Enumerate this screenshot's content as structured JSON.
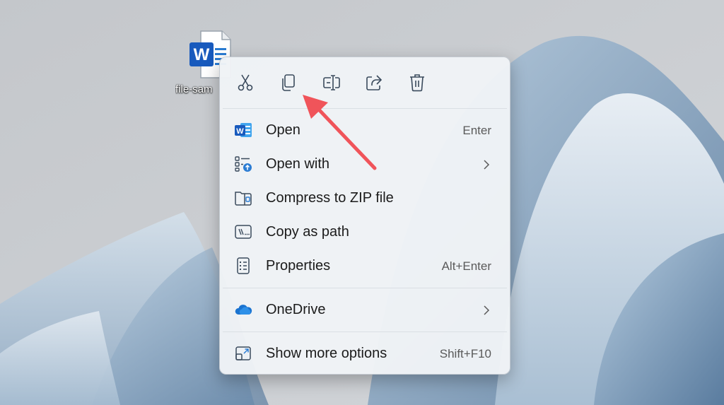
{
  "desktop": {
    "file_icon": {
      "icon": "word-document-icon",
      "label": "file-sam"
    }
  },
  "context_menu": {
    "quick_actions": [
      {
        "name": "cut-button",
        "icon": "scissors-icon"
      },
      {
        "name": "copy-button",
        "icon": "copy-icon"
      },
      {
        "name": "rename-button",
        "icon": "rename-icon"
      },
      {
        "name": "share-button",
        "icon": "share-icon"
      },
      {
        "name": "delete-button",
        "icon": "trash-icon"
      }
    ],
    "items": [
      {
        "label": "Open",
        "shortcut": "Enter",
        "icon": "word-icon"
      },
      {
        "label": "Open with",
        "shortcut": "",
        "icon": "open-with-icon",
        "submenu": true
      },
      {
        "label": "Compress to ZIP file",
        "shortcut": "",
        "icon": "zip-folder-icon"
      },
      {
        "label": "Copy as path",
        "shortcut": "",
        "icon": "path-icon"
      },
      {
        "label": "Properties",
        "shortcut": "Alt+Enter",
        "icon": "properties-icon"
      },
      {
        "label": "OneDrive",
        "shortcut": "",
        "icon": "onedrive-cloud-icon",
        "submenu": true
      },
      {
        "label": "Show more options",
        "shortcut": "Shift+F10",
        "icon": "more-options-icon"
      }
    ]
  },
  "annotation": {
    "arrow_color": "#f0545a",
    "points_to": "copy-button"
  },
  "colors": {
    "accent": "#2b7cd3",
    "icon_stroke": "#3a4a5c",
    "word_blue": "#185abd"
  }
}
